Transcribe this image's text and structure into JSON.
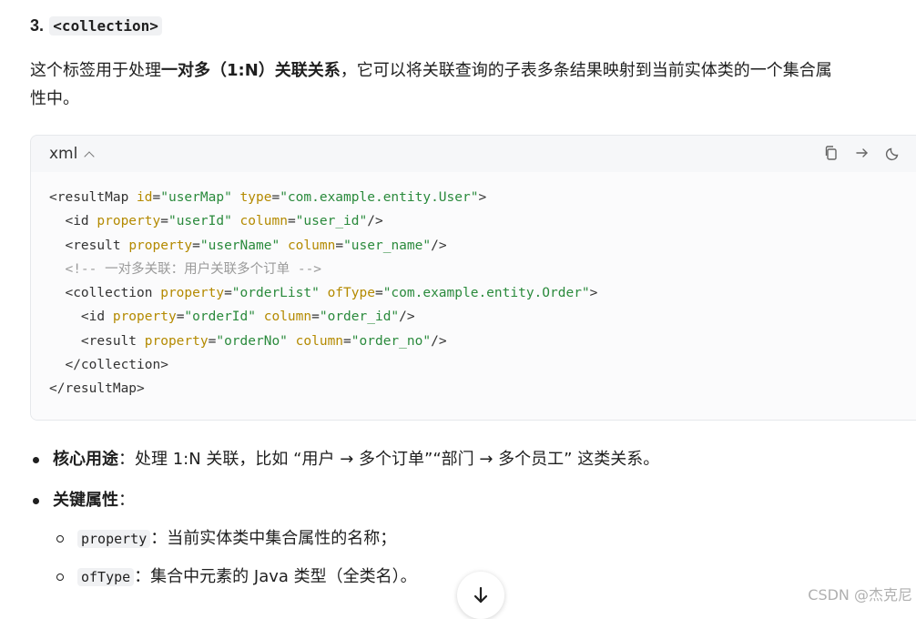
{
  "heading": {
    "number": "3.",
    "code": "<collection>"
  },
  "paragraph": {
    "before": "这个标签用于处理",
    "bold": "一对多（1:N）关联关系",
    "after": "，它可以将关联查询的子表多条结果映射到当前实体类的一个集合属",
    "line2": "性中。"
  },
  "code_block": {
    "language": "xml",
    "tools": [
      "copy-icon",
      "wrap-icon",
      "theme-icon",
      "expand-icon"
    ],
    "lines": [
      [
        {
          "t": "tag",
          "v": "<resultMap "
        },
        {
          "t": "attr",
          "v": "id"
        },
        {
          "t": "tag",
          "v": "="
        },
        {
          "t": "str",
          "v": "\"userMap\""
        },
        {
          "t": "tag",
          "v": " "
        },
        {
          "t": "attr",
          "v": "type"
        },
        {
          "t": "tag",
          "v": "="
        },
        {
          "t": "str",
          "v": "\"com.example.entity.User\""
        },
        {
          "t": "tag",
          "v": ">"
        }
      ],
      [
        {
          "t": "tag",
          "v": "  <id "
        },
        {
          "t": "attr",
          "v": "property"
        },
        {
          "t": "tag",
          "v": "="
        },
        {
          "t": "str",
          "v": "\"userId\""
        },
        {
          "t": "tag",
          "v": " "
        },
        {
          "t": "attr",
          "v": "column"
        },
        {
          "t": "tag",
          "v": "="
        },
        {
          "t": "str",
          "v": "\"user_id\""
        },
        {
          "t": "tag",
          "v": "/>"
        }
      ],
      [
        {
          "t": "tag",
          "v": "  <result "
        },
        {
          "t": "attr",
          "v": "property"
        },
        {
          "t": "tag",
          "v": "="
        },
        {
          "t": "str",
          "v": "\"userName\""
        },
        {
          "t": "tag",
          "v": " "
        },
        {
          "t": "attr",
          "v": "column"
        },
        {
          "t": "tag",
          "v": "="
        },
        {
          "t": "str",
          "v": "\"user_name\""
        },
        {
          "t": "tag",
          "v": "/>"
        }
      ],
      [
        {
          "t": "comment",
          "v": "  <!-- 一对多关联：用户关联多个订单 -->"
        }
      ],
      [
        {
          "t": "tag",
          "v": "  <collection "
        },
        {
          "t": "attr",
          "v": "property"
        },
        {
          "t": "tag",
          "v": "="
        },
        {
          "t": "str",
          "v": "\"orderList\""
        },
        {
          "t": "tag",
          "v": " "
        },
        {
          "t": "attr",
          "v": "ofType"
        },
        {
          "t": "tag",
          "v": "="
        },
        {
          "t": "str",
          "v": "\"com.example.entity.Order\""
        },
        {
          "t": "tag",
          "v": ">"
        }
      ],
      [
        {
          "t": "tag",
          "v": "    <id "
        },
        {
          "t": "attr",
          "v": "property"
        },
        {
          "t": "tag",
          "v": "="
        },
        {
          "t": "str",
          "v": "\"orderId\""
        },
        {
          "t": "tag",
          "v": " "
        },
        {
          "t": "attr",
          "v": "column"
        },
        {
          "t": "tag",
          "v": "="
        },
        {
          "t": "str",
          "v": "\"order_id\""
        },
        {
          "t": "tag",
          "v": "/>"
        }
      ],
      [
        {
          "t": "tag",
          "v": "    <result "
        },
        {
          "t": "attr",
          "v": "property"
        },
        {
          "t": "tag",
          "v": "="
        },
        {
          "t": "str",
          "v": "\"orderNo\""
        },
        {
          "t": "tag",
          "v": " "
        },
        {
          "t": "attr",
          "v": "column"
        },
        {
          "t": "tag",
          "v": "="
        },
        {
          "t": "str",
          "v": "\"order_no\""
        },
        {
          "t": "tag",
          "v": "/>"
        }
      ],
      [
        {
          "t": "tag",
          "v": "  </collection>"
        }
      ],
      [
        {
          "t": "tag",
          "v": "</resultMap>"
        }
      ]
    ]
  },
  "bullets": {
    "core_use": {
      "label": "核心用途",
      "text": "：处理 1:N 关联，比如 “用户 → 多个订单”“部门 → 多个员工” 这类关系。"
    },
    "key_attrs": {
      "label": "关键属性",
      "text": "："
    },
    "sub_items": [
      {
        "code": "property",
        "text": "：当前实体类中集合属性的名称；"
      },
      {
        "code": "ofType",
        "text": "：集合中元素的 Java 类型（全类名）。"
      }
    ]
  },
  "scroll_button": {
    "icon": "arrow-down-icon"
  },
  "watermark": "CSDN @杰克尼"
}
